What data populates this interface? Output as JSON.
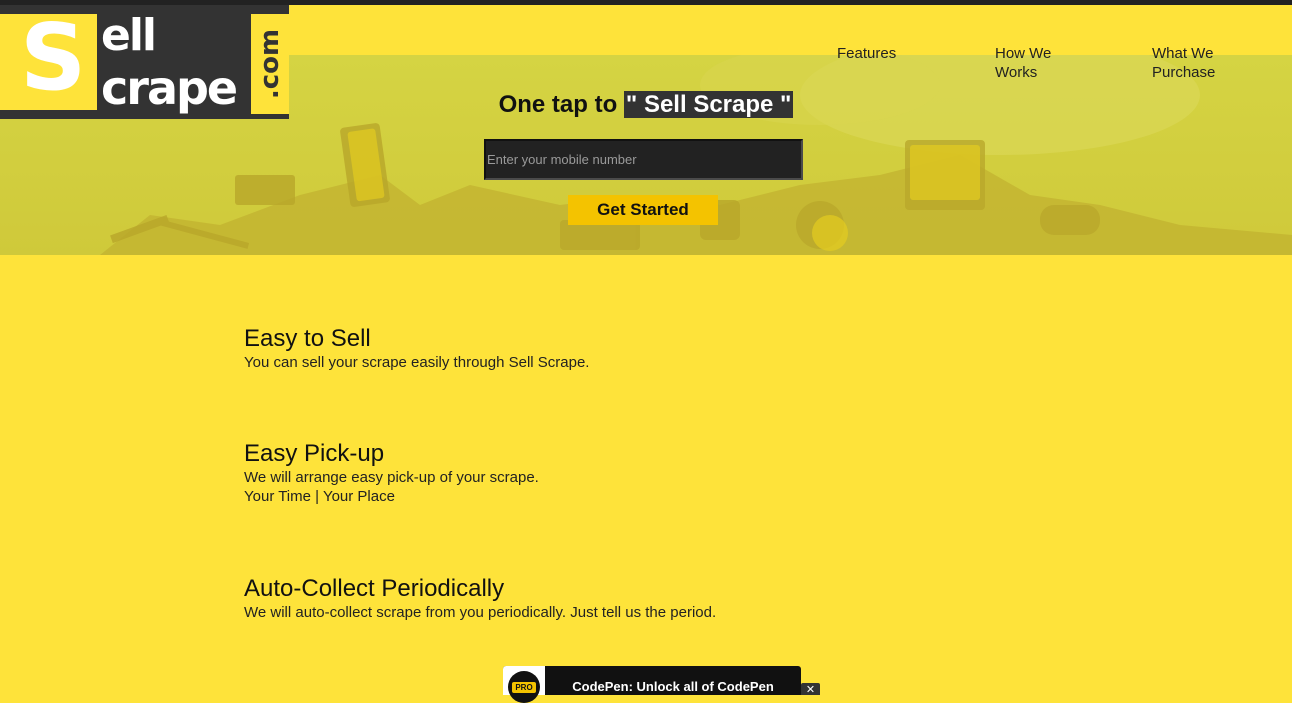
{
  "logo": {
    "letter_s": "S",
    "part_ell": "ell",
    "part_crape": "crape",
    "part_com": ".com"
  },
  "nav": {
    "items": [
      {
        "label": "Features"
      },
      {
        "label": "How We Works"
      },
      {
        "label": "What We Purchase"
      }
    ]
  },
  "hero": {
    "tagline_prefix": "One tap to ",
    "tagline_highlight": "\" Sell Scrape \"",
    "mobile_placeholder": "Enter your mobile number",
    "mobile_value": "",
    "cta_label": "Get Started"
  },
  "features": [
    {
      "title": "Easy to Sell",
      "lines": [
        "You can sell your scrape easily through Sell Scrape."
      ]
    },
    {
      "title": "Easy Pick-up",
      "lines": [
        "We will arrange easy pick-up of your scrape.",
        "Your Time | Your Place"
      ]
    },
    {
      "title": "Auto-Collect Periodically",
      "lines": [
        "We will auto-collect scrape from you periodically. Just tell us the period."
      ]
    }
  ],
  "codepen_banner": {
    "badge": "PRO",
    "text": "CodePen: Unlock all of CodePen",
    "close_icon": "close-icon"
  },
  "colors": {
    "brand_yellow": "#fee33a",
    "dark": "#333333",
    "button_yellow": "#f4c300"
  }
}
